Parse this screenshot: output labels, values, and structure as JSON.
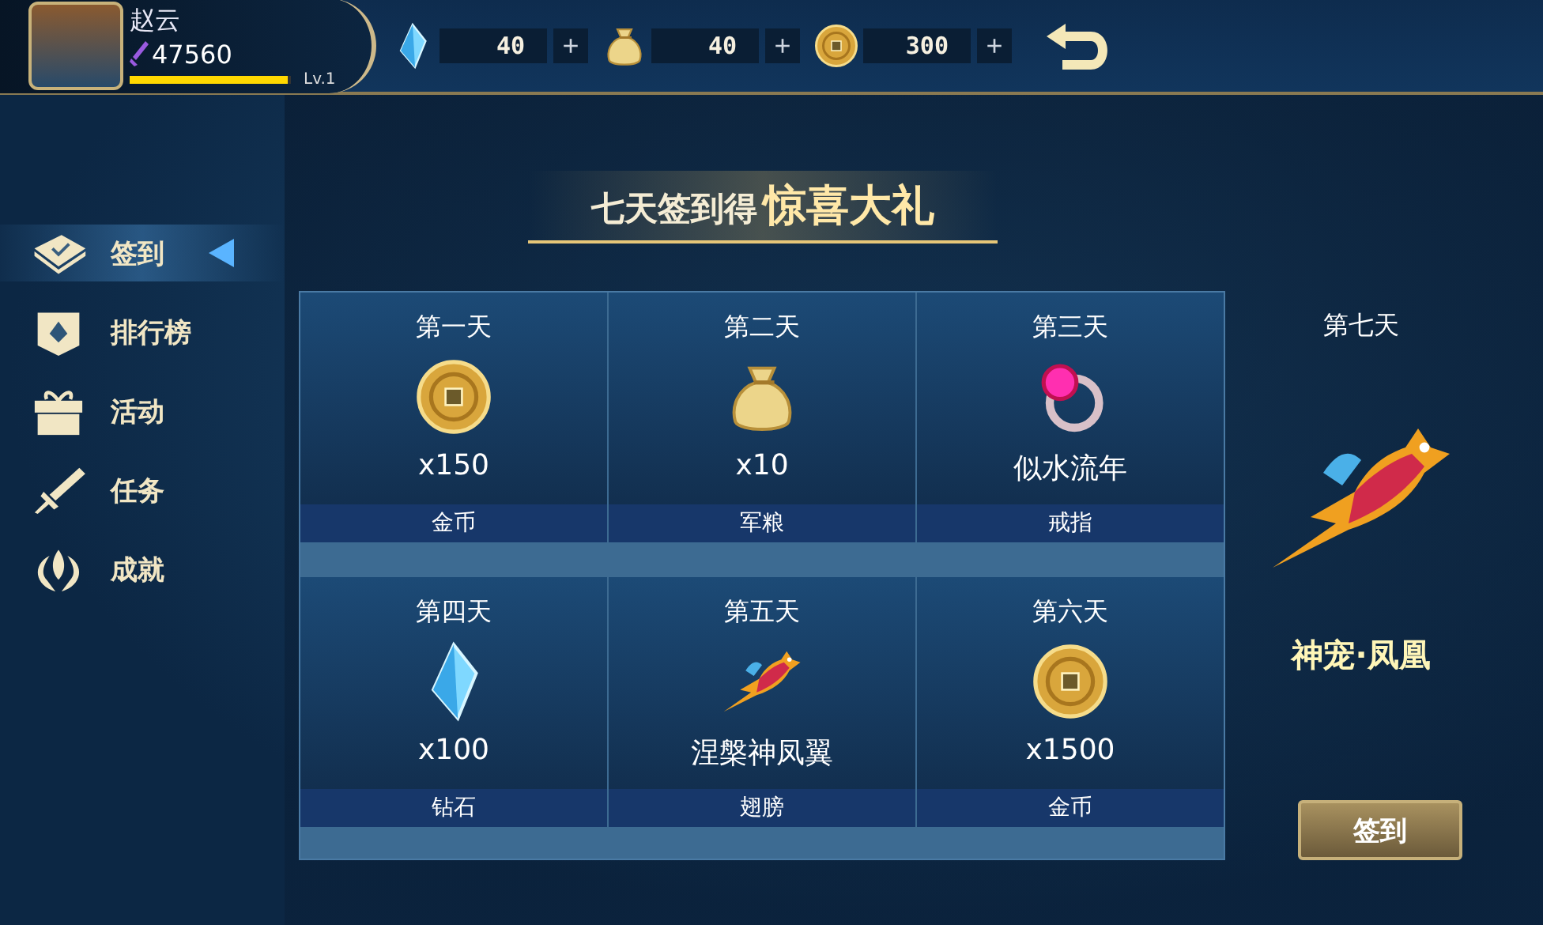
{
  "player": {
    "name": "赵云",
    "power": "47560",
    "level_label": "Lv.1",
    "level": 0.98
  },
  "currencies": [
    {
      "kind": "crystal",
      "amount": "40",
      "add": "+"
    },
    {
      "kind": "bag",
      "amount": "40",
      "add": "+"
    },
    {
      "kind": "coin",
      "amount": "300",
      "add": "+"
    }
  ],
  "sidebar": {
    "items": [
      {
        "kind": "book",
        "label": "签到",
        "selected": true
      },
      {
        "kind": "banner",
        "label": "排行榜",
        "selected": false
      },
      {
        "kind": "gift",
        "label": "活动",
        "selected": false
      },
      {
        "kind": "sword",
        "label": "任务",
        "selected": false
      },
      {
        "kind": "wings",
        "label": "成就",
        "selected": false
      }
    ]
  },
  "banner": {
    "title": "七天签到得",
    "highlight": "惊喜大礼"
  },
  "rewards": [
    {
      "day": "第一天",
      "kind": "coin",
      "amount": "x150",
      "name": "金币"
    },
    {
      "day": "第二天",
      "kind": "bag",
      "amount": "x10",
      "name": "军粮"
    },
    {
      "day": "第三天",
      "kind": "ring",
      "amount": "似水流年",
      "name": "戒指"
    },
    {
      "day": "第四天",
      "kind": "crystal",
      "amount": "x100",
      "name": "钻石"
    },
    {
      "day": "第五天",
      "kind": "phoenix",
      "amount": "涅槃神凤翼",
      "name": "翅膀"
    },
    {
      "day": "第六天",
      "kind": "coin",
      "amount": "x1500",
      "name": "金币"
    }
  ],
  "final_reward": {
    "day": "第七天",
    "kind": "phoenix",
    "name": "神宠·凤凰"
  },
  "sign_in_button": "签到"
}
